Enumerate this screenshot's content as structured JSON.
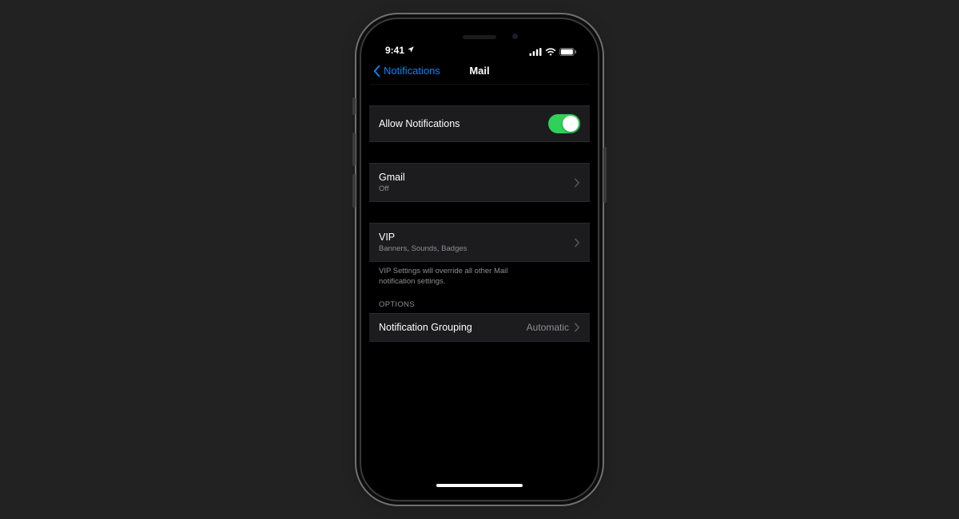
{
  "status": {
    "time": "9:41",
    "location_icon": "location-arrow",
    "cellular_bars": 4,
    "wifi": true,
    "battery_level": 100
  },
  "nav": {
    "back_label": "Notifications",
    "title": "Mail"
  },
  "allow": {
    "label": "Allow Notifications",
    "enabled": true
  },
  "accounts": [
    {
      "name": "Gmail",
      "detail": "Off"
    }
  ],
  "vip": {
    "name": "VIP",
    "detail": "Banners, Sounds, Badges",
    "footnote": "VIP Settings will override all other Mail notification settings."
  },
  "options": {
    "header": "OPTIONS",
    "grouping_label": "Notification Grouping",
    "grouping_value": "Automatic"
  },
  "colors": {
    "accent": "#0a84ff",
    "toggle_on": "#30d158",
    "cell_bg": "#1c1c1e",
    "secondary_text": "#8e8e93"
  }
}
